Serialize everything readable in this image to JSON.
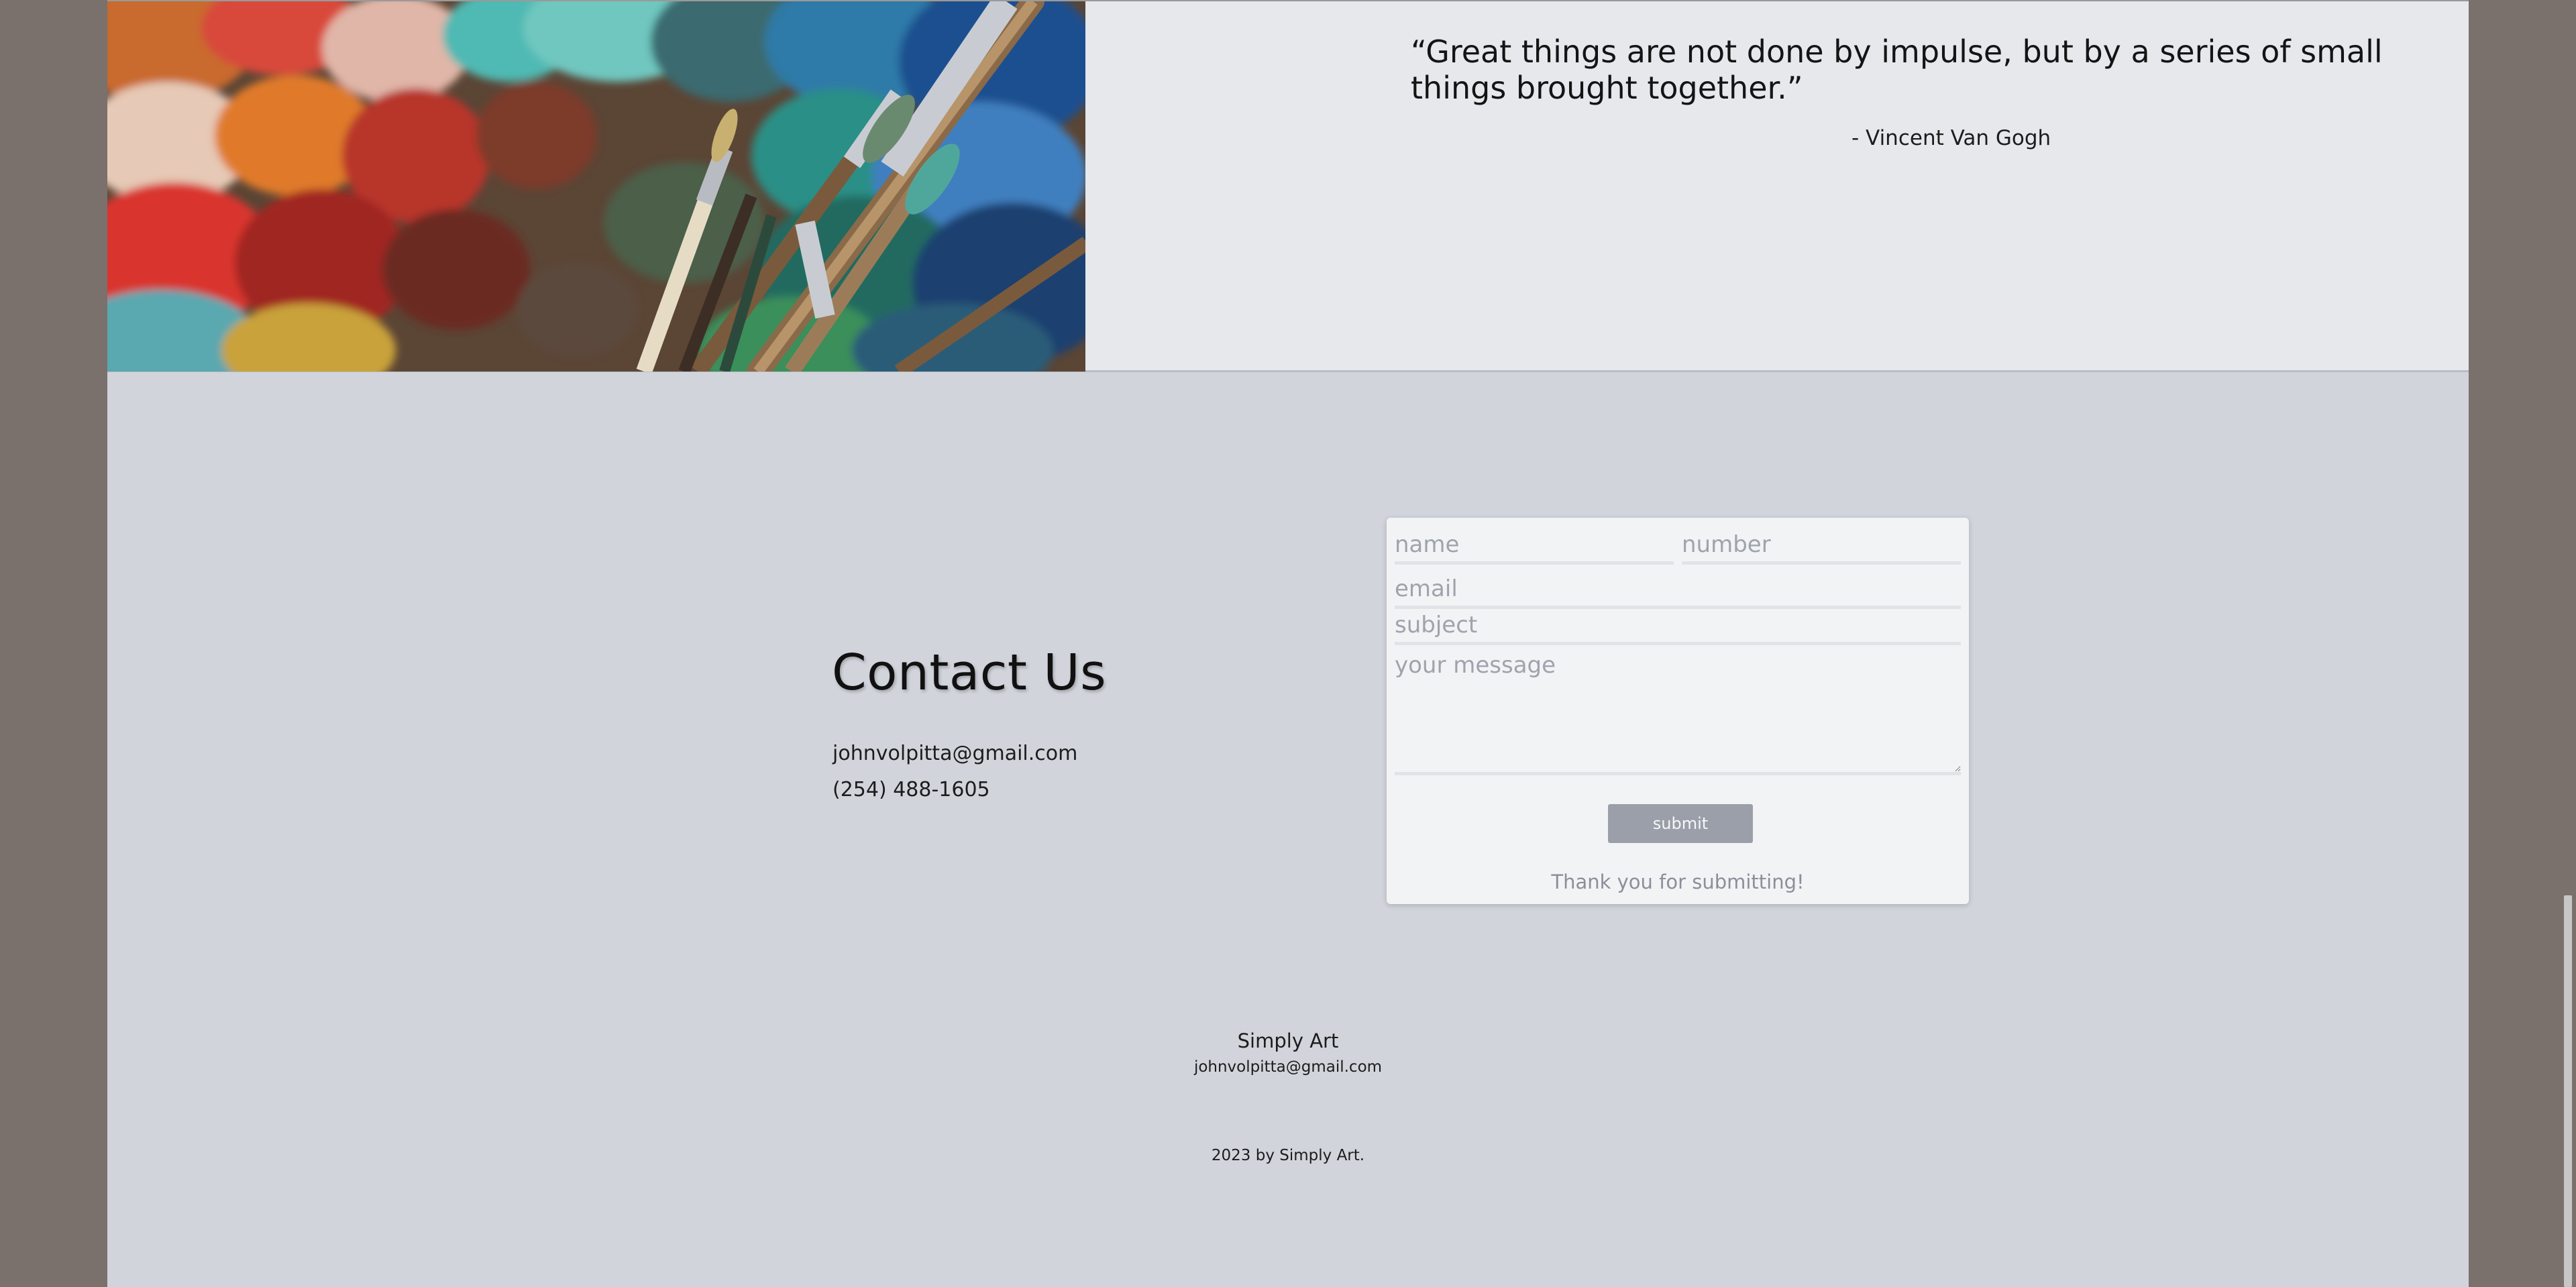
{
  "quote": {
    "text": "“Great things are not done by impulse, but by a series of small things brought together.”",
    "author": "- Vincent Van Gogh"
  },
  "contact": {
    "title": "Contact Us",
    "email": "johnvolpitta@gmail.com",
    "phone": "(254) 488-1605"
  },
  "form": {
    "name_placeholder": "name",
    "number_placeholder": "number",
    "email_placeholder": "email",
    "subject_placeholder": "subject",
    "message_placeholder": "your message",
    "submit_label": "submit",
    "confirmation": "Thank you for submitting!"
  },
  "footer": {
    "site_name": "Simply Art",
    "email": "johnvolpitta@gmail.com",
    "copyright": "2023 by Simply Art."
  },
  "colors": {
    "page_background": "#d1d4db",
    "outer_background": "#7a716d",
    "submit_button": "#9a9fa9"
  }
}
